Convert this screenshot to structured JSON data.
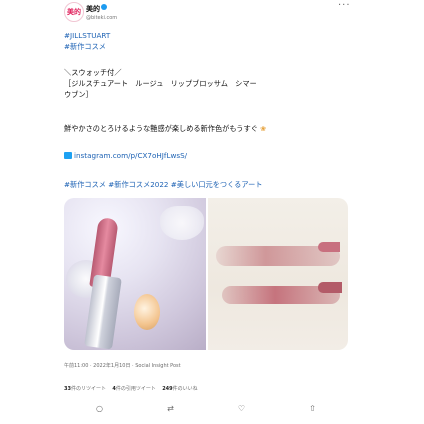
{
  "header": {
    "avatar_text": "美的",
    "display_name": "美的",
    "handle": "@biteki.com",
    "more_icon": "more-dots-icon"
  },
  "tweet": {
    "hashtag_line1": "#JILLSTUART",
    "hashtag_line2": "#新作コスメ",
    "body_line1": "＼スウォッチ付／",
    "body_line2": "［ジルスチュアート　ルージュ　リップブロッサム　シマー",
    "body_line3": "ウブン］",
    "body_line4": "鮮やかさのとろけるような艶感が楽しめる新作色がもうすぐ",
    "link_text": "instagram.com/p/CX7oHJfLwsS/",
    "hashtags_bottom": "#新作コスメ #新作コスメ2022 #美しい口元をつくるアート"
  },
  "meta": {
    "time_line": "午前11:00 · 2022年1月10日 · Social Insight Post"
  },
  "stats": {
    "retweets_num": "33",
    "retweets_label": "件のリツイート",
    "quotes_num": "4",
    "quotes_label": "件の引用ツイート",
    "likes_num": "249",
    "likes_label": "件のいいね"
  },
  "actions": {
    "reply_icon": "reply-icon",
    "retweet_icon": "retweet-icon",
    "like_icon": "like-icon",
    "share_icon": "share-icon"
  }
}
